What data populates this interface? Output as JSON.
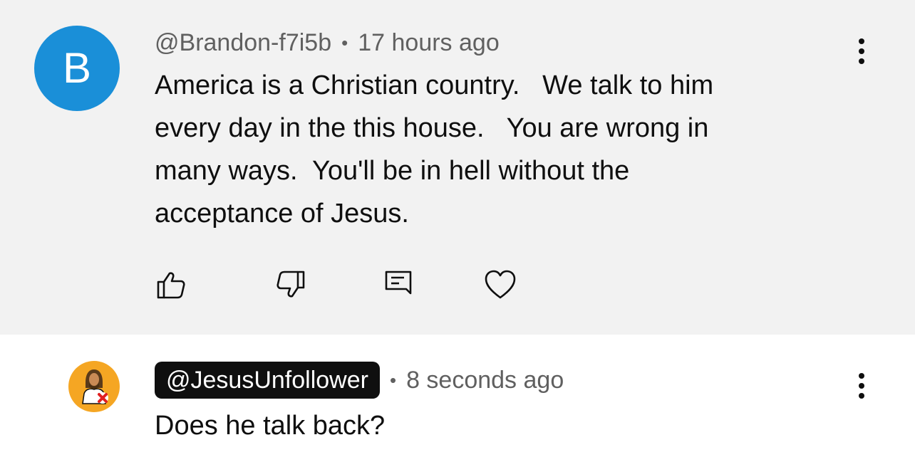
{
  "comments": [
    {
      "avatar_letter": "B",
      "author": "@Brandon-f7i5b",
      "separator": "•",
      "time": "17 hours ago",
      "lines": [
        "America is a Christian country.   We talk to him",
        "every day in the this house.   You are wrong in",
        "many ways.  You'll be in hell without the",
        "acceptance of Jesus."
      ],
      "actions": [
        "thumbs-up-icon",
        "thumbs-down-icon",
        "reply-icon",
        "heart-icon"
      ],
      "menu_icon": "more-vertical-icon",
      "avatar_color": "#1a8fd8"
    },
    {
      "author": "@JesusUnfollower",
      "separator": "•",
      "time": "8 seconds ago",
      "lines": [
        "Does he talk back?"
      ],
      "menu_icon": "more-vertical-icon",
      "avatar_color": "#f5a623"
    }
  ],
  "colors": {
    "highlight_background": "#f2f2f2",
    "author_badge": "#0f0f0f",
    "meta_text": "#606060",
    "body_text": "#0f0f0f"
  }
}
